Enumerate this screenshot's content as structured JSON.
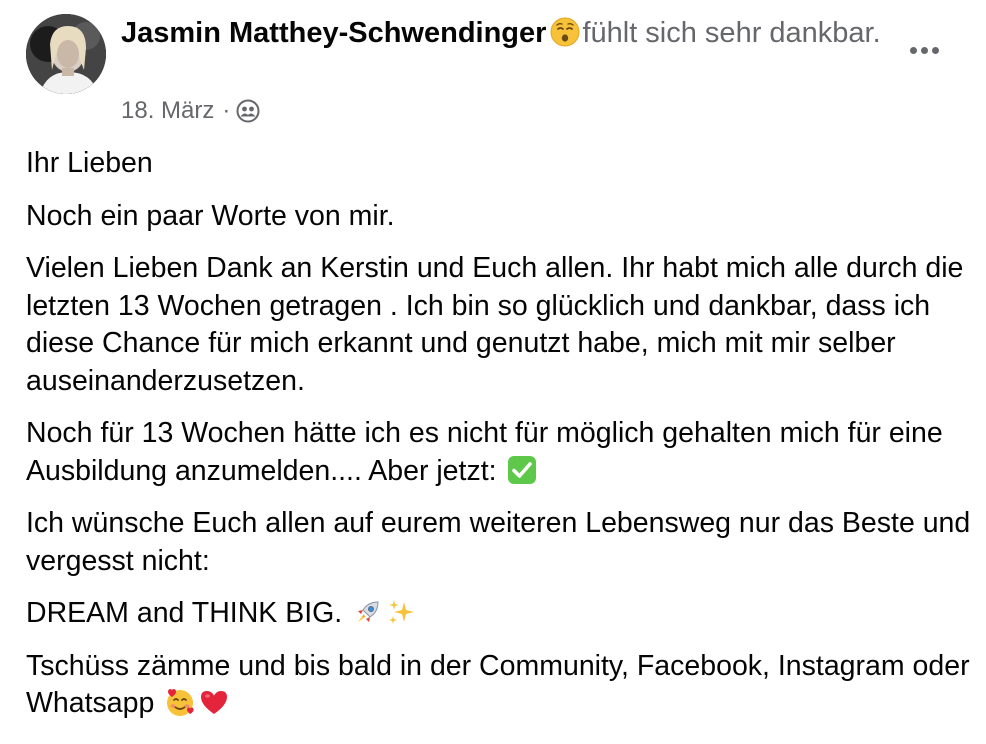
{
  "post": {
    "author": "Jasmin Matthey-Schwendinger",
    "feeling_icon": "relieved-face-emoji",
    "feeling_text": "fühlt sich sehr dankbar.",
    "date": "18. März",
    "separator": "·",
    "audience_icon": "friends-audience-icon",
    "more_icon": "more-options-icon",
    "paragraphs": [
      {
        "text": "Ihr Lieben"
      },
      {
        "text": "Noch ein paar Worte von mir."
      },
      {
        "text": "Vielen Lieben Dank an Kerstin und Euch allen. Ihr habt mich alle durch die letzten 13 Wochen getragen .  Ich bin so glücklich und dankbar, dass ich diese Chance für mich erkannt und genutzt habe, mich mit mir selber auseinanderzusetzen."
      },
      {
        "text": "Noch für 13 Wochen hätte ich es nicht für möglich gehalten mich für eine Ausbildung anzumelden.... Aber jetzt:",
        "emojis": [
          "check-mark-emoji"
        ]
      },
      {
        "text": "Ich wünsche Euch allen auf eurem weiteren Lebensweg nur das Beste und vergesst nicht:"
      },
      {
        "text": "DREAM and THINK BIG.",
        "emojis": [
          "rocket-emoji",
          "sparkles-emoji"
        ]
      },
      {
        "text": "Tschüss zämme und bis bald in der Community, Facebook, Instagram oder Whatsapp",
        "emojis": [
          "smiling-face-with-hearts-emoji",
          "red-heart-emoji"
        ]
      }
    ]
  },
  "colors": {
    "text_primary": "#050505",
    "text_secondary": "#65676b",
    "check_green": "#5ec84a",
    "heart_red": "#e3243b"
  }
}
